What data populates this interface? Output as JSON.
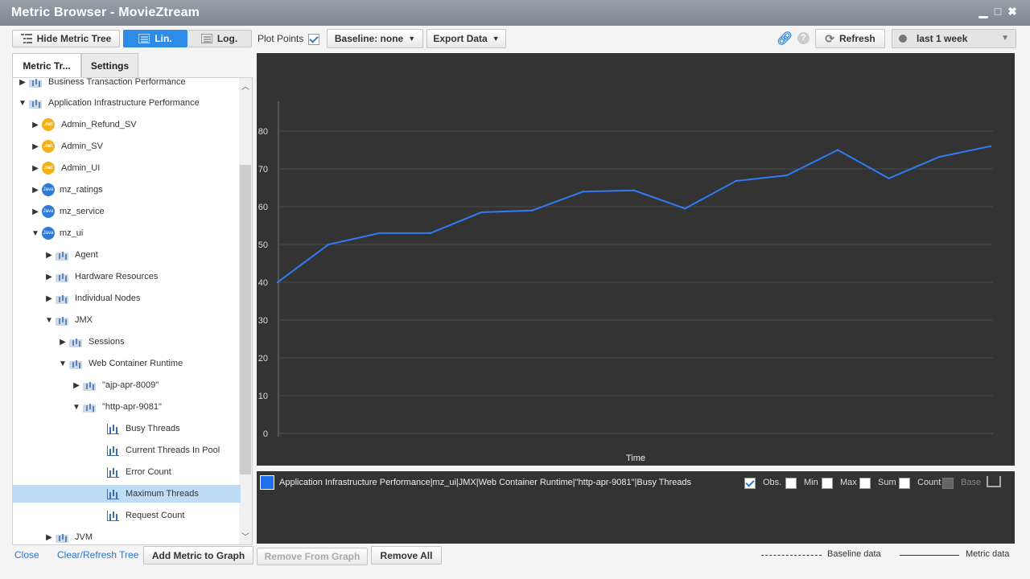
{
  "window": {
    "title": "Metric Browser - MovieZtream"
  },
  "toolbar": {
    "hide_tree": "Hide Metric Tree",
    "lin": "Lin.",
    "log": "Log.",
    "plot_points": "Plot Points",
    "plot_points_checked": true,
    "baseline": "Baseline:  none",
    "export": "Export Data",
    "refresh": "Refresh",
    "time_range": "last 1 week"
  },
  "tabs": [
    {
      "label": "Metric Tr..."
    },
    {
      "label": "Settings"
    }
  ],
  "tree": [
    {
      "label": "Business Transaction Performance",
      "icon": "folder-icon",
      "arrow": "▶"
    },
    {
      "label": "Application Infrastructure Performance",
      "icon": "folder-icon",
      "arrow": "▼"
    },
    {
      "label": "Admin_Refund_SV",
      "icon": "net-icon",
      "icon_text": ".net",
      "arrow": "▶"
    },
    {
      "label": "Admin_SV",
      "icon": "net-icon",
      "icon_text": ".net",
      "arrow": "▶"
    },
    {
      "label": "Admin_UI",
      "icon": "net-icon",
      "icon_text": ".net",
      "arrow": "▶"
    },
    {
      "label": "mz_ratings",
      "icon": "java-icon",
      "icon_text": "Java",
      "arrow": "▶"
    },
    {
      "label": "mz_service",
      "icon": "java-icon",
      "icon_text": "Java",
      "arrow": "▶"
    },
    {
      "label": "mz_ui",
      "icon": "java-icon",
      "icon_text": "Java",
      "arrow": "▼"
    },
    {
      "label": "Agent",
      "icon": "folder-icon",
      "arrow": "▶"
    },
    {
      "label": "Hardware Resources",
      "icon": "folder-icon",
      "arrow": "▶"
    },
    {
      "label": "Individual Nodes",
      "icon": "folder-icon",
      "arrow": "▶"
    },
    {
      "label": "JMX",
      "icon": "folder-icon",
      "arrow": "▼"
    },
    {
      "label": "Sessions",
      "icon": "folder-icon",
      "arrow": "▶"
    },
    {
      "label": "Web Container Runtime",
      "icon": "folder-icon",
      "arrow": "▼"
    },
    {
      "label": "\"ajp-apr-8009\"",
      "icon": "folder-icon",
      "arrow": "▶"
    },
    {
      "label": "\"http-apr-9081\"",
      "icon": "folder-icon",
      "arrow": "▼"
    },
    {
      "label": "Busy Threads",
      "icon": "metric-icon",
      "arrow": ""
    },
    {
      "label": "Current Threads In Pool",
      "icon": "metric-icon",
      "arrow": ""
    },
    {
      "label": "Error Count",
      "icon": "metric-icon",
      "arrow": ""
    },
    {
      "label": "Maximum Threads",
      "icon": "metric-icon",
      "arrow": "",
      "selected": true
    },
    {
      "label": "Request Count",
      "icon": "metric-icon",
      "arrow": ""
    },
    {
      "label": "JVM",
      "icon": "folder-icon",
      "arrow": "▶"
    }
  ],
  "chart_data": {
    "type": "line",
    "xlabel": "Time",
    "ylabel": "",
    "ylim": [
      0,
      80
    ],
    "yticks": [
      0,
      10,
      20,
      30,
      40,
      50,
      60,
      70,
      80
    ],
    "grid": true,
    "series": [
      {
        "name": "Application Infrastructure Performance|mz_ui|JMX|Web Container Runtime|\"http-apr-9081\"|Busy Threads",
        "color": "#2f7cf6",
        "values": [
          40,
          50,
          53,
          53,
          58.5,
          59,
          64,
          64.3,
          59.5,
          66.8,
          68.3,
          75,
          67.5,
          73.2,
          76
        ]
      }
    ]
  },
  "legend": {
    "series_label": "Application Infrastructure Performance|mz_ui|JMX|Web Container Runtime|\"http-apr-9081\"|Busy Threads",
    "obs": "Obs.",
    "min": "Min",
    "max": "Max",
    "sum": "Sum",
    "count": "Count",
    "base": "Base"
  },
  "footer": {
    "close": "Close",
    "clear_refresh": "Clear/Refresh Tree",
    "add_metric": "Add Metric to Graph",
    "remove_from": "Remove From Graph",
    "remove_all": "Remove All",
    "baseline_data": "Baseline data",
    "metric_data": "Metric data"
  },
  "colors": {
    "accent": "#2e8be8",
    "chart_bg": "#333333",
    "line": "#2f7cf6"
  }
}
